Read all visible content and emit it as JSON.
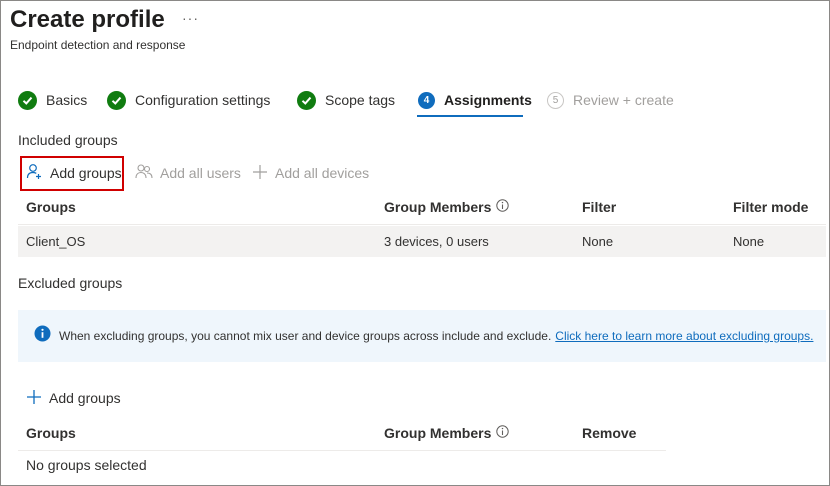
{
  "header": {
    "title": "Create profile",
    "more": "···",
    "subtitle": "Endpoint detection and response"
  },
  "steps": [
    {
      "label": "Basics",
      "state": "done"
    },
    {
      "label": "Configuration settings",
      "state": "done"
    },
    {
      "label": "Scope tags",
      "state": "done"
    },
    {
      "label": "Assignments",
      "number": "4",
      "state": "current"
    },
    {
      "label": "Review + create",
      "number": "5",
      "state": "upcoming"
    }
  ],
  "included": {
    "heading": "Included groups",
    "toolbar": {
      "add_groups": "Add groups",
      "add_all_users": "Add all users",
      "add_all_devices": "Add all devices"
    },
    "columns": [
      "Groups",
      "Group Members",
      "Filter",
      "Filter mode"
    ],
    "rows": [
      {
        "group": "Client_OS",
        "members": "3 devices, 0 users",
        "filter": "None",
        "filter_mode": "None"
      }
    ]
  },
  "excluded": {
    "heading": "Excluded groups",
    "banner_text": "When excluding groups, you cannot mix user and device groups across include and exclude.",
    "banner_link": "Click here to learn more about excluding groups.",
    "add_groups": "Add groups",
    "columns": [
      "Groups",
      "Group Members",
      "Remove"
    ],
    "empty_text": "No groups selected"
  },
  "colors": {
    "accent": "#0f6cbd",
    "success": "#107c10",
    "highlight_box": "#d00000",
    "banner_bg": "#eff6fc"
  }
}
